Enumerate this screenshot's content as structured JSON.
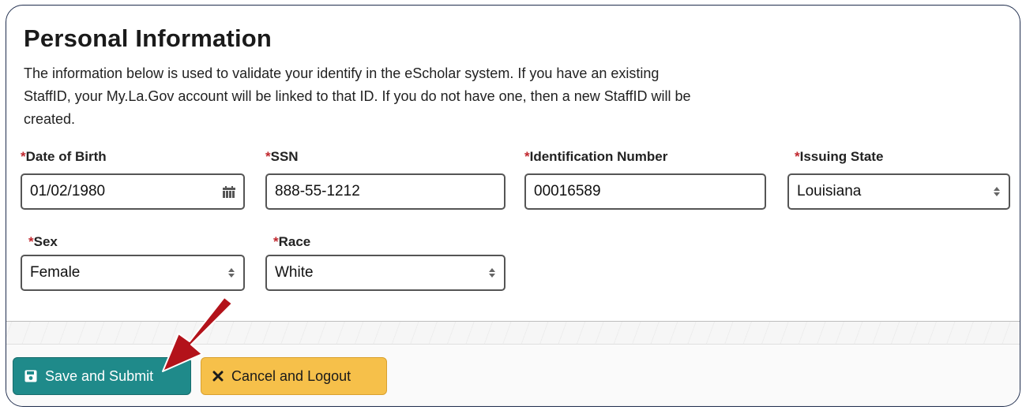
{
  "form": {
    "title": "Personal Information",
    "intro": "The information below is used to validate your identify in the eScholar system. If you have an existing StaffID, your My.La.Gov account will be linked to that ID. If you do not have one, then a new StaffID will be created.",
    "required_marker": "*"
  },
  "fields": {
    "dob": {
      "label": "Date of Birth",
      "value": "01/02/1980"
    },
    "ssn": {
      "label": "SSN",
      "value": "888-55-1212"
    },
    "id_number": {
      "label": "Identification Number",
      "value": "00016589"
    },
    "issuing_state": {
      "label": "Issuing State",
      "value": "Louisiana"
    },
    "sex": {
      "label": "Sex",
      "value": "Female"
    },
    "race": {
      "label": "Race",
      "value": "White"
    }
  },
  "actions": {
    "save_label": "Save and Submit",
    "cancel_label": "Cancel and Logout"
  },
  "colors": {
    "required": "#c0262d",
    "save_button": "#1f8a8a",
    "cancel_button": "#f6c04a",
    "annotation_arrow": "#b3121a"
  },
  "icons": {
    "date": "calendar-icon",
    "select": "select-arrows-icon",
    "save": "floppy-disk-icon",
    "cancel": "close-icon",
    "annotation": "red-arrow-annotation"
  }
}
